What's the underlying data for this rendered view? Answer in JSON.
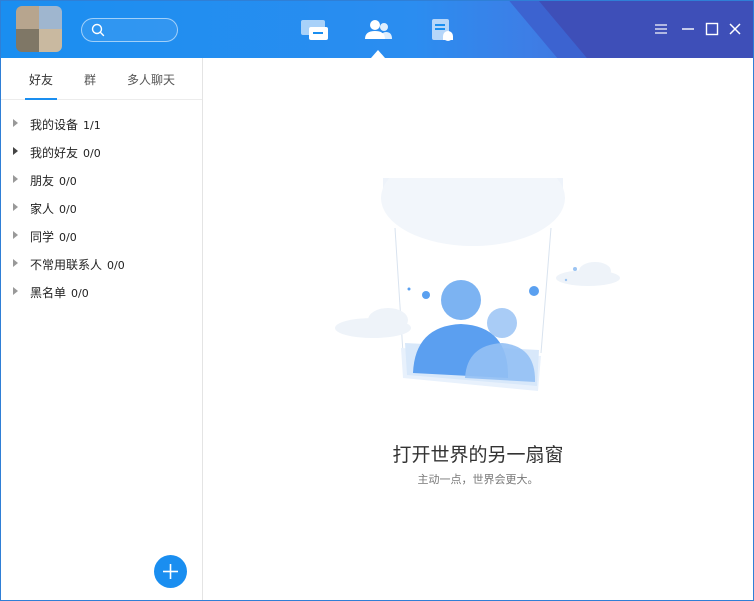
{
  "header": {
    "search_placeholder": "",
    "nav": [
      {
        "name": "messages",
        "icon": "chat-bubble-icon"
      },
      {
        "name": "contacts",
        "icon": "contacts-icon",
        "active": true
      },
      {
        "name": "docs",
        "icon": "document-icon"
      }
    ],
    "window_controls": [
      "menu-icon",
      "minimize-icon",
      "maximize-icon",
      "close-icon"
    ],
    "colors": {
      "accent": "#1a8ef0",
      "deco": "#3e4fb8"
    }
  },
  "sidebar": {
    "tabs": [
      {
        "label": "好友",
        "active": true
      },
      {
        "label": "群"
      },
      {
        "label": "多人聊天"
      }
    ],
    "groups": [
      {
        "name": "我的设备",
        "count": "1/1"
      },
      {
        "name": "我的好友",
        "count": "0/0"
      },
      {
        "name": "朋友",
        "count": "0/0"
      },
      {
        "name": "家人",
        "count": "0/0"
      },
      {
        "name": "同学",
        "count": "0/0"
      },
      {
        "name": "不常用联系人",
        "count": "0/0"
      },
      {
        "name": "黑名单",
        "count": "0/0"
      }
    ]
  },
  "main": {
    "title": "打开世界的另一扇窗",
    "subtitle": "主动一点，世界会更大。"
  }
}
